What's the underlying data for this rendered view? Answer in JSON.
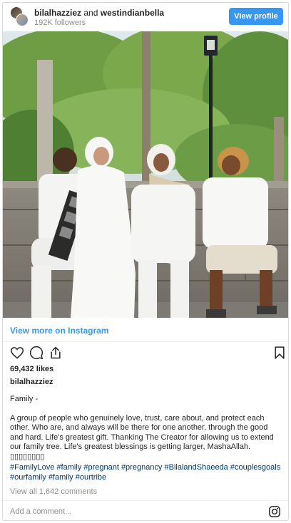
{
  "header": {
    "user1": "bilalhazziez",
    "conjunction": "and",
    "user2": "westindianbella",
    "followers": "192K followers",
    "view_profile_label": "View profile"
  },
  "post": {
    "view_more_label": "View more on Instagram",
    "likes": "69,432 likes",
    "owner": "bilalhazziez",
    "caption_title": "Family -",
    "caption_body": "A group of people who genuinely love, trust, care about, and protect each other. Who are, and always will be there for one another, through the good and hard. Life's greatest gift. Thanking The Creator for allowing us to extend our family tree. Life's greatest blessings is getting larger, MashaAllah. ▯▯▯▯▯▯▯▯",
    "hashtags": [
      "#FamilyLove",
      "#family",
      "#pregnant",
      "#pregnancy",
      "#BilalandShaeeda",
      "#couplesgoals",
      "#ourfamily",
      "#family",
      "#ourtribe"
    ],
    "view_all_comments": "View all 1,642 comments"
  },
  "comment": {
    "placeholder": "Add a comment..."
  },
  "icons": {
    "like": "heart-icon",
    "comment": "comment-icon",
    "share": "share-icon",
    "save": "bookmark-icon",
    "brand": "instagram-icon"
  },
  "colors": {
    "accent": "#3897f0",
    "hashtag": "#00376b",
    "muted": "#8e8e8e"
  }
}
